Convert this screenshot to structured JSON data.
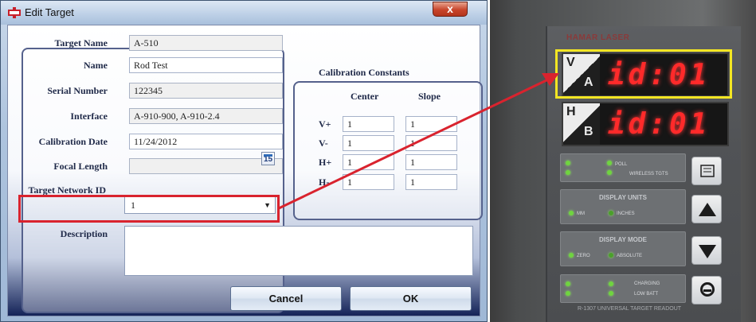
{
  "window": {
    "title": "Edit Target",
    "close_glyph": "x"
  },
  "form": {
    "target_name": {
      "label": "Target Name",
      "value": "A-510"
    },
    "name": {
      "label": "Name",
      "value": "Rod Test"
    },
    "serial_number": {
      "label": "Serial Number",
      "value": "122345"
    },
    "interface": {
      "label": "Interface",
      "value": "A-910-900, A-910-2.4"
    },
    "calibration_date": {
      "label": "Calibration Date",
      "value": "11/24/2012",
      "picker_day": "15"
    },
    "focal_length": {
      "label": "Focal Length",
      "value": ""
    },
    "target_network_id": {
      "label": "Target Network ID",
      "value": "1"
    },
    "description": {
      "label": "Description",
      "value": ""
    }
  },
  "calibration": {
    "title": "Calibration Constants",
    "col_center": "Center",
    "col_slope": "Slope",
    "rows": [
      {
        "label": "V+",
        "center": "1",
        "slope": "1"
      },
      {
        "label": "V-",
        "center": "1",
        "slope": "1"
      },
      {
        "label": "H+",
        "center": "1",
        "slope": "1"
      },
      {
        "label": "H-",
        "center": "1",
        "slope": "1"
      }
    ]
  },
  "buttons": {
    "cancel": "Cancel",
    "ok": "OK"
  },
  "device": {
    "brand": "HAMAR LASER",
    "display_v": {
      "top_letter": "V",
      "bottom_letter": "A",
      "readout": "id:01"
    },
    "display_h": {
      "top_letter": "H",
      "bottom_letter": "B",
      "readout": "id:01"
    },
    "display_units": {
      "title": "DISPLAY UNITS",
      "opt1": "MM",
      "opt2": "INCHES"
    },
    "display_mode": {
      "title": "DISPLAY MODE",
      "opt1": "ZERO",
      "opt2": "ABSOLUTE"
    },
    "status_labels": {
      "charging": "CHARGING",
      "low_batt": "LOW BATT",
      "poll": "POLL",
      "wireless": "WIRELESS TGTS"
    },
    "footer": "R-1307 UNIVERSAL TARGET READOUT"
  },
  "colors": {
    "highlight_red": "#d9232e",
    "highlight_yellow": "#f3e623",
    "led_red": "#ff2a2a"
  }
}
